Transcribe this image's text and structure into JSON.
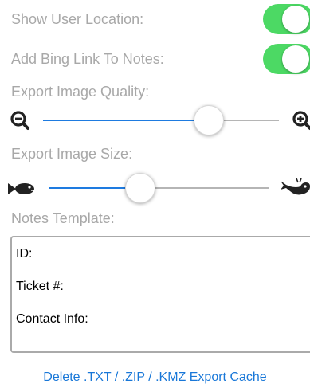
{
  "settings": {
    "show_user_location": {
      "label": "Show User Location:",
      "on": true
    },
    "add_bing_link": {
      "label": "Add Bing Link To Notes:",
      "on": true
    },
    "export_image_quality": {
      "label": "Export Image Quality:",
      "value_fraction": 0.7,
      "min_icon": "zoom-out-icon",
      "max_icon": "zoom-in-icon"
    },
    "export_image_size": {
      "label": "Export Image Size:",
      "value_fraction": 0.41,
      "min_icon": "small-fish-icon",
      "max_icon": "whale-icon"
    }
  },
  "notes_template": {
    "label": "Notes Template:",
    "lines": [
      "ID:",
      "Ticket #:",
      "Contact Info:"
    ]
  },
  "actions": {
    "delete_cache_label": "Delete .TXT / .ZIP / .KMZ Export Cache"
  },
  "colors": {
    "toggle_on": "#4cd964",
    "slider_fill": "#1e7be0",
    "link": "#1877d8",
    "label": "#a8a8a8"
  }
}
